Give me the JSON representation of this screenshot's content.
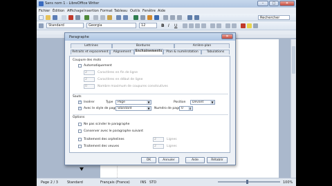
{
  "window": {
    "title": "Sans nom 1 - LibreOffice Writer"
  },
  "menubar": [
    "Fichier",
    "Édition",
    "Affichage",
    "Insertion",
    "Format",
    "Tableau",
    "Outils",
    "Fenêtre",
    "Aide"
  ],
  "toolbar": {
    "style": "Standard",
    "font": "Georgia",
    "size": "12",
    "search_placeholder": "Rechercher"
  },
  "dialog": {
    "title": "Paragraphe",
    "tabs_row1": [
      "Lettrines",
      "Bordures",
      "Arrière-plan"
    ],
    "tabs_row2": [
      "Retraits et espacement",
      "Alignement",
      "Enchaînements",
      "Plan & numérotation",
      "Tabulations"
    ],
    "hyphenation": {
      "heading": "Coupure des mots",
      "auto_label": "Automatiquement",
      "rows": [
        {
          "value": "2",
          "label": "Caractères en fin de ligne"
        },
        {
          "value": "2",
          "label": "Caractères en début de ligne"
        },
        {
          "value": "0",
          "label": "Nombre maximum de coupures consécutives"
        }
      ]
    },
    "breaks": {
      "heading": "Sauts",
      "insert_label": "Insérer",
      "type_label": "Type",
      "type_value": "Page",
      "position_label": "Position",
      "position_value": "Devant",
      "with_style_label": "Avec le style de page",
      "style_value": "Standard",
      "page_number_label": "Numéro de page",
      "page_number_value": "0"
    },
    "options": {
      "heading": "Options",
      "items": [
        "Ne pas scinder le paragraphe",
        "Conserver avec le paragraphe suivant",
        "Traitement des orphelines",
        "Traitement des veuves"
      ],
      "orphan_value": "2",
      "widow_value": "2",
      "lines_label": "Lignes"
    },
    "buttons": {
      "ok": "OK",
      "cancel": "Annuler",
      "help": "Aide",
      "reset": "Rétablir"
    }
  },
  "status": {
    "page": "Page 2 / 3",
    "style": "Standard",
    "language": "Français (France)",
    "mode1": "INS",
    "mode2": "STD",
    "zoom": "100%"
  },
  "colors": {
    "accent": "#3a6bbf",
    "panel": "#ffffff",
    "doc_bg": "#aab8cc"
  }
}
